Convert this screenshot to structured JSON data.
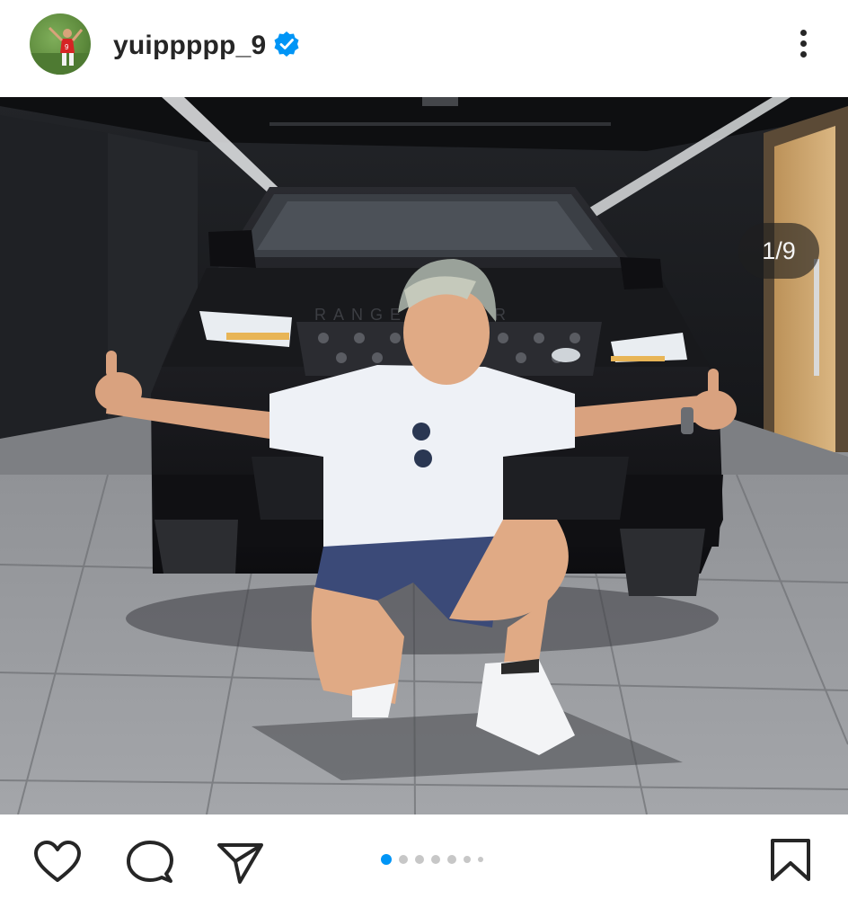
{
  "post": {
    "username": "yuippppp_9",
    "verified": true,
    "image_counter": "1/9",
    "carousel": {
      "total_dots": 7,
      "active_index": 0
    },
    "photo_text": {
      "car_badge": "RANGE ROVER"
    },
    "icons": {
      "avatar": "profile-photo",
      "verified": "verified-badge-icon",
      "more": "more-options-icon",
      "like": "heart-icon",
      "comment": "comment-icon",
      "share": "send-icon",
      "save": "bookmark-icon"
    },
    "colors": {
      "verified_blue": "#0095f6",
      "active_dot": "#0095f6",
      "inactive_dot": "#c7c7c7",
      "icon_dark": "#262626"
    }
  }
}
